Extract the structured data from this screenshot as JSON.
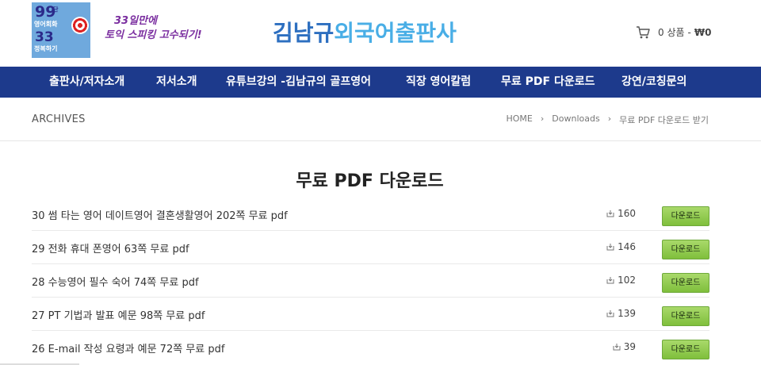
{
  "header": {
    "book": {
      "big1": "99",
      "big1_suffix": "단",
      "line2": "영어회화",
      "big3": "33",
      "line4": "정복하기"
    },
    "slogan_line1": "33일만에",
    "slogan_line2": "토익 스피킹 고수되기!",
    "site_title_a": "김남규",
    "site_title_b": "외국어출판사",
    "cart": {
      "count": "0 상품",
      "separator": "-",
      "amount": "₩0"
    }
  },
  "nav": [
    "출판사/저자소개",
    "저서소개",
    "유튜브강의 -김남규의 골프영어",
    "직장 영어칼럼",
    "무료 PDF 다운로드",
    "강연/코칭문의"
  ],
  "breadcrumb_bar": {
    "archives": "ARCHIVES",
    "crumbs": [
      "HOME",
      "›",
      "Downloads",
      "›",
      "무료 PDF 다운로드 받기"
    ]
  },
  "main": {
    "heading": "무료 PDF 다운로드",
    "button_label": "다운로드",
    "items": [
      {
        "title": "30 썸 타는 영어 데이트영어 결혼생활영어 202쪽 무료 pdf",
        "count": "160"
      },
      {
        "title": "29 전화 휴대 폰영어 63쪽 무료 pdf",
        "count": "146"
      },
      {
        "title": "28 수능영어 필수 숙어 74쪽 무료 pdf",
        "count": "102"
      },
      {
        "title": "27 PT 기법과 발표 예문 98쪽 무료 pdf",
        "count": "139"
      },
      {
        "title": "26 E-mail 작성 요령과 예문 72쪽 무료 pdf",
        "count": "39"
      }
    ]
  },
  "icons": {
    "cart": "cart-icon",
    "download": "download-icon"
  },
  "colors": {
    "nav_bg": "#1d3a8c",
    "title_blue": "#49aee6",
    "button_green": "#8fc94e"
  }
}
